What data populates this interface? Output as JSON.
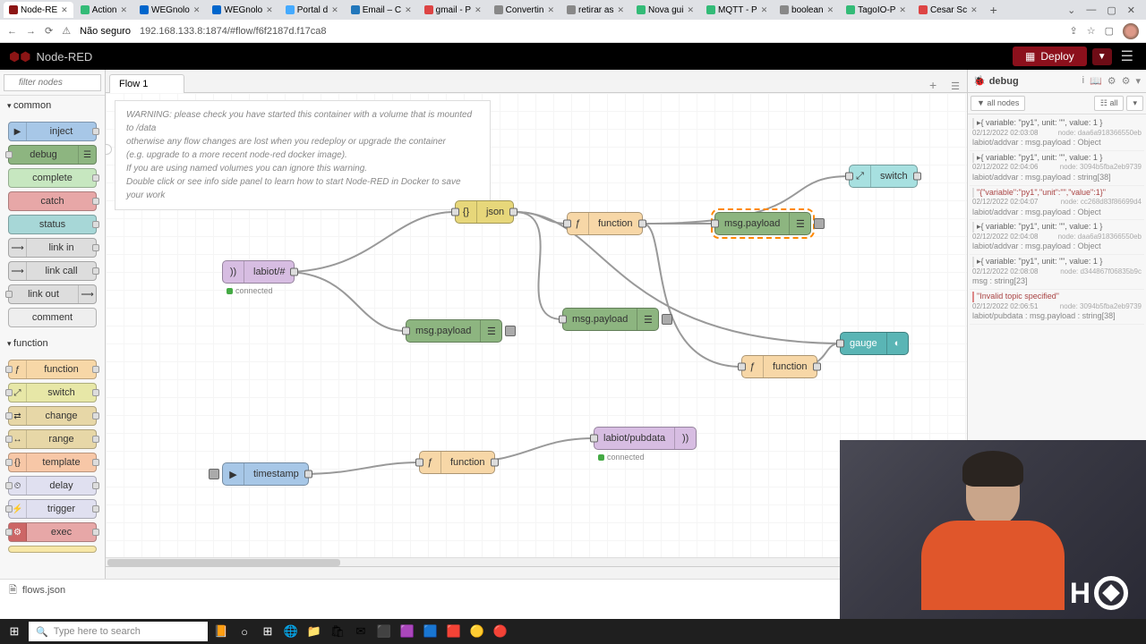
{
  "browser": {
    "tabs": [
      "Node-RE",
      "Action",
      "WEGnolo",
      "WEGnolo",
      "Portal d",
      "Email – C",
      "gmail - P",
      "Convertin",
      "retirar as",
      "Nova gui",
      "MQTT - P",
      "boolean",
      "TagoIO-P",
      "Cesar Sc"
    ],
    "win": {
      "min": "—",
      "max": "▢",
      "close": "✕",
      "down": "⌄"
    },
    "nav": {
      "back": "←",
      "fwd": "→",
      "reload": "⟳"
    },
    "insecure": "Não seguro",
    "url": "192.168.133.8:1874/#flow/f6f2187d.f17ca8",
    "addtab": "+"
  },
  "header": {
    "brand": "Node-RED",
    "deploy": "Deploy"
  },
  "palette": {
    "filter_placeholder": "filter nodes",
    "cat_common": "common",
    "cat_function": "function",
    "common": [
      "inject",
      "debug",
      "complete",
      "catch",
      "status",
      "link in",
      "link call",
      "link out",
      "comment"
    ],
    "function": [
      "function",
      "switch",
      "change",
      "range",
      "template",
      "delay",
      "trigger",
      "exec"
    ]
  },
  "flow": {
    "tab": "Flow 1",
    "info": {
      "l1": "WARNING: please check you have started this container with a volume that is mounted to /data",
      "l2": "otherwise any flow changes are lost when you redeploy or upgrade the container",
      "l3": "(e.g. upgrade to a more recent node-red docker image).",
      "l4": "If you are using named volumes you can ignore this warning.",
      "l5": "Double click or see info side panel to learn how to start Node-RED in Docker to save your work"
    },
    "nodes": {
      "mqtt_in": "labiot/#",
      "mqtt_in_status": "connected",
      "json": "json",
      "debug1": "msg.payload",
      "func1": "function",
      "debug2": "msg.payload",
      "debug3": "msg.payload",
      "switch": "switch",
      "gauge": "gauge",
      "func2": "function",
      "inject": "timestamp",
      "func3": "function",
      "mqtt_out": "labiot/pubdata",
      "mqtt_out_status": "connected"
    }
  },
  "sidebar": {
    "title": "debug",
    "filter_all": "▼ all nodes",
    "filter_all2": "☷ all",
    "msgs": [
      {
        "pre": "▸{ variable: \"py1\", unit: \"\", value: 1 }",
        "ts": "02/12/2022 02:03:08",
        "node": "node: daa6a918366550eb",
        "prop": "labiot/addvar : msg.payload : Object"
      },
      {
        "pre": "▸{ variable: \"py1\", unit: \"\", value: 1 }",
        "ts": "02/12/2022 02:04:06",
        "node": "node: 3094b5fba2eb9739",
        "prop": "labiot/addvar : msg.payload : string[38]"
      },
      {
        "str": "\"{\"variable\":\"py1\",\"unit\":\"\",\"value\":1}\"",
        "ts": "02/12/2022 02:04:07",
        "node": "node: cc268d83f86699d4",
        "prop": "labiot/addvar : msg.payload : Object"
      },
      {
        "pre": "▸{ variable: \"py1\", unit: \"\", value: 1 }",
        "ts": "02/12/2022 02:04:08",
        "node": "node: daa6a918366550eb",
        "prop": "labiot/addvar : msg.payload : Object"
      },
      {
        "pre": "▸{ variable: \"py1\", unit: \"\", value: 1 }",
        "ts": "02/12/2022 02:08:08",
        "node": "node: d344867f06835b9c",
        "prop": "msg : string[23]"
      },
      {
        "str": "\"Invalid topic specified\"",
        "err": true,
        "ts": "02/12/2022 02:06:51",
        "node": "node: 3094b5fba2eb9739",
        "prop": "labiot/pubdata : msg.payload : string[38]"
      }
    ]
  },
  "statusbar": {
    "file": "flows.json"
  },
  "taskbar": {
    "search": "Type here to search"
  }
}
